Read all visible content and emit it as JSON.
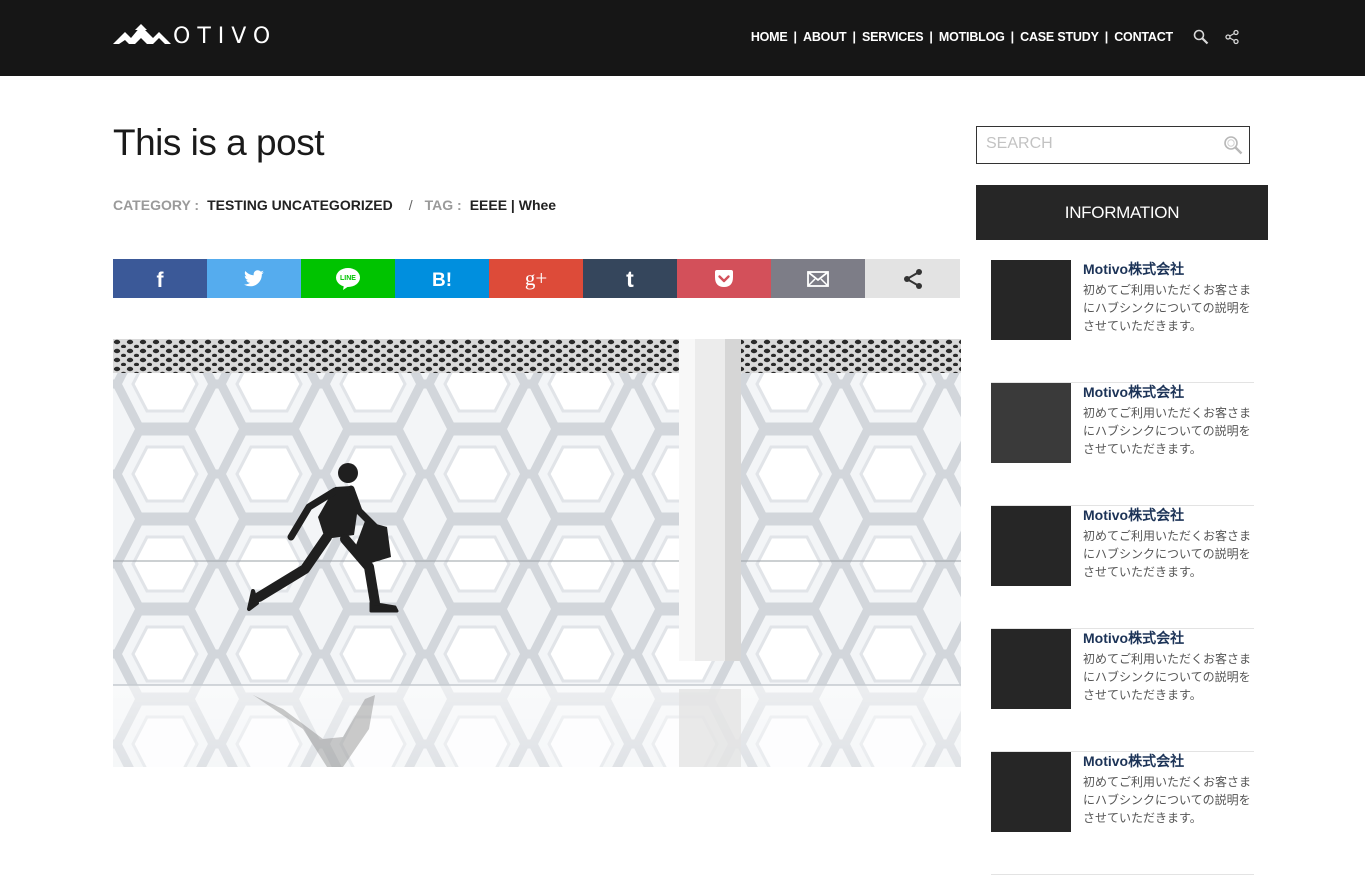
{
  "brand": {
    "logo_text": "OTIVO"
  },
  "nav": {
    "items": [
      "HOME",
      "ABOUT",
      "SERVICES",
      "MOTIBLOG",
      "CASE STUDY",
      "CONTACT"
    ],
    "separator": "|"
  },
  "header_icons": [
    "search-icon",
    "share-icon"
  ],
  "post": {
    "title": "This is a post",
    "category_label": "CATEGORY :",
    "category_value": "TESTING UNCATEGORIZED",
    "divider": "/",
    "tag_label": "TAG :",
    "tag_value": "EEEE | Whee"
  },
  "share_buttons": [
    {
      "name": "facebook",
      "color": "#3b5998",
      "glyph": "f"
    },
    {
      "name": "twitter",
      "color": "#55acee",
      "glyph": ""
    },
    {
      "name": "line",
      "color": "#00c300",
      "glyph": "LINE"
    },
    {
      "name": "hatena",
      "color": "#008fde",
      "glyph": "B!"
    },
    {
      "name": "google-plus",
      "color": "#dd4b39",
      "glyph": "g+"
    },
    {
      "name": "tumblr",
      "color": "#35465c",
      "glyph": "t"
    },
    {
      "name": "pocket",
      "color": "#d3505a",
      "glyph": ""
    },
    {
      "name": "email",
      "color": "#7d7d87",
      "glyph": ""
    },
    {
      "name": "share",
      "color": "#e3e3e3",
      "glyph": ""
    }
  ],
  "sidebar": {
    "search_placeholder": "SEARCH",
    "info_title": "INFORMATION",
    "items": [
      {
        "title": "Motivo株式会社",
        "desc": "初めてご利用いただくお客さまにハブシンクについての説明をさせていただきます。",
        "thumb_color": "#262626"
      },
      {
        "title": "Motivo株式会社",
        "desc": "初めてご利用いただくお客さまにハブシンクについての説明をさせていただきます。",
        "thumb_color": "#3a3a3a"
      },
      {
        "title": "Motivo株式会社",
        "desc": "初めてご利用いただくお客さまにハブシンクについての説明をさせていただきます。",
        "thumb_color": "#262626"
      },
      {
        "title": "Motivo株式会社",
        "desc": "初めてご利用いただくお客さまにハブシンクについての説明をさせていただきます。",
        "thumb_color": "#262626"
      },
      {
        "title": "Motivo株式会社",
        "desc": "初めてご利用いただくお客さまにハブシンクについての説明をさせていただきます。",
        "thumb_color": "#262626"
      }
    ]
  },
  "colors": {
    "header_bg": "#161616",
    "info_bg": "#262626",
    "title_link": "#1c3357"
  }
}
